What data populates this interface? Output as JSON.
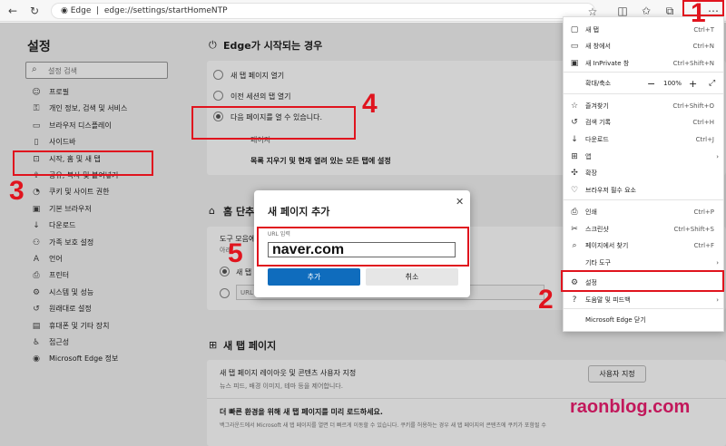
{
  "browser": {
    "address_brand": "Edge",
    "address_url": "edge://settings/startHomeNTP"
  },
  "sidebar": {
    "title": "설정",
    "search_placeholder": "설정 검색",
    "items": [
      {
        "label": "프로필",
        "icon": "profile-icon"
      },
      {
        "label": "개인 정보, 검색 및 서비스",
        "icon": "lock-icon"
      },
      {
        "label": "브라우저 디스플레이",
        "icon": "display-icon"
      },
      {
        "label": "사이드바",
        "icon": "sidebar-icon"
      },
      {
        "label": "시작, 홈 및 새 탭",
        "icon": "home-tab-icon"
      },
      {
        "label": "공유, 복사 및 붙여넣기",
        "icon": "share-icon"
      },
      {
        "label": "쿠키 및 사이트 권한",
        "icon": "cookie-icon"
      },
      {
        "label": "기본 브라우저",
        "icon": "browser-icon"
      },
      {
        "label": "다운로드",
        "icon": "download-icon"
      },
      {
        "label": "가족 보호 설정",
        "icon": "family-icon"
      },
      {
        "label": "언어",
        "icon": "language-icon"
      },
      {
        "label": "프린터",
        "icon": "printer-icon"
      },
      {
        "label": "시스템 및 성능",
        "icon": "system-icon"
      },
      {
        "label": "원래대로 설정",
        "icon": "reset-icon"
      },
      {
        "label": "휴대폰 및 기타 장치",
        "icon": "phone-icon"
      },
      {
        "label": "접근성",
        "icon": "accessibility-icon"
      },
      {
        "label": "Microsoft Edge 정보",
        "icon": "edge-logo-icon"
      }
    ]
  },
  "main": {
    "startup": {
      "title": "Edge가 시작되는 경우",
      "options": [
        "새 탭 페이지 열기",
        "이전 세션의 탭 열기",
        "다음 페이지를 열 수 있습니다."
      ],
      "pages_label": "페이지",
      "clear_label": "목록 지우기 및 현재 열려 있는 모든 탭에 설정"
    },
    "home": {
      "title": "홈 단추",
      "toolbar_label": "도구 모음에",
      "toolbar_sub": "아래",
      "option_new_tab": "새 탭",
      "url_placeholder": "URL"
    },
    "newtab": {
      "title": "새 탭 페이지",
      "customize_title": "새 탭 페이지 레이아웃 및 콘텐츠 사용자 지정",
      "customize_sub": "뉴스 피드, 배경 이미지, 테마 등을 제어합니다.",
      "customize_button": "사용자 지정",
      "preload_title": "더 빠른 환경을 위해 새 탭 페이지를 미리 로드하세요.",
      "preload_sub": "백그라운드에서 Microsoft 새 탭 페이지를 열면 더 빠르게 이동할 수 있습니다. 쿠키를 허용하는 경우 새 탭 페이지의 콘텐츠에 쿠키가 포함될 수"
    }
  },
  "dialog": {
    "title": "새 페이지 추가",
    "url_label": "URL 입력",
    "url_value": "naver.com",
    "add_label": "추가",
    "cancel_label": "취소"
  },
  "menu": {
    "items": [
      {
        "label": "새 탭",
        "shortcut": "Ctrl+T",
        "icon": "new-tab-icon"
      },
      {
        "label": "새 창에서",
        "shortcut": "Ctrl+N",
        "icon": "new-window-icon"
      },
      {
        "label": "새 InPrivate 창",
        "shortcut": "Ctrl+Shift+N",
        "icon": "inprivate-icon"
      },
      {
        "label": "확대/축소",
        "zoom": "100%",
        "icon": ""
      },
      {
        "label": "즐겨찾기",
        "shortcut": "Ctrl+Shift+O",
        "icon": "star-icon"
      },
      {
        "label": "검색 기록",
        "shortcut": "Ctrl+H",
        "icon": "history-icon"
      },
      {
        "label": "다운로드",
        "shortcut": "Ctrl+J",
        "icon": "download-icon"
      },
      {
        "label": "앱",
        "arrow": true,
        "icon": "apps-icon"
      },
      {
        "label": "확장",
        "icon": "extension-icon"
      },
      {
        "label": "브라우저 필수 요소",
        "icon": "heart-pulse-icon"
      },
      {
        "label": "인쇄",
        "shortcut": "Ctrl+P",
        "icon": "print-icon"
      },
      {
        "label": "스크린샷",
        "shortcut": "Ctrl+Shift+S",
        "icon": "screenshot-icon"
      },
      {
        "label": "페이지에서 찾기",
        "shortcut": "Ctrl+F",
        "icon": "find-icon"
      },
      {
        "label": "기타 도구",
        "arrow": true,
        "icon": ""
      },
      {
        "label": "설정",
        "icon": "gear-icon"
      },
      {
        "label": "도움말 및 피드백",
        "arrow": true,
        "icon": "help-icon"
      },
      {
        "label": "Microsoft Edge 닫기",
        "icon": ""
      }
    ]
  },
  "annotations": {
    "n1": "1",
    "n2": "2",
    "n3": "3",
    "n4": "4",
    "n5": "5",
    "watermark": "raonblog.com",
    "color": "#e0141e"
  }
}
